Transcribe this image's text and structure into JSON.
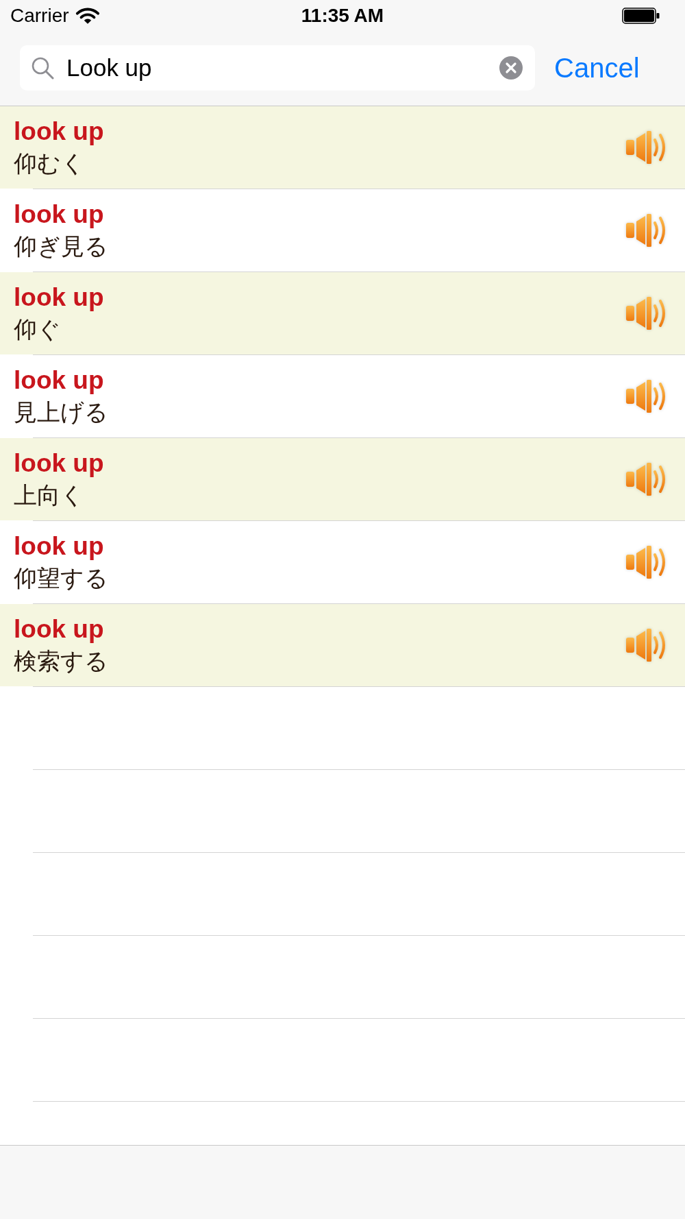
{
  "status_bar": {
    "carrier": "Carrier",
    "time": "11:35 AM"
  },
  "search": {
    "value": "Look up",
    "cancel_label": "Cancel"
  },
  "results": [
    {
      "term": "look up",
      "translation": "仰むく"
    },
    {
      "term": "look up",
      "translation": "仰ぎ見る"
    },
    {
      "term": "look up",
      "translation": "仰ぐ"
    },
    {
      "term": "look up",
      "translation": "見上げる"
    },
    {
      "term": "look up",
      "translation": "上向く"
    },
    {
      "term": "look up",
      "translation": "仰望する"
    },
    {
      "term": "look up",
      "translation": "検索する"
    }
  ]
}
